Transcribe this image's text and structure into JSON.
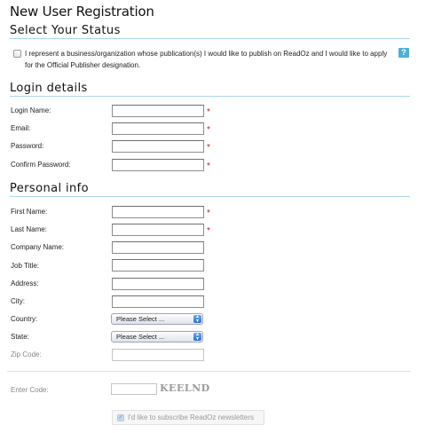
{
  "page": {
    "title": "New User Registration"
  },
  "status": {
    "heading": "Select Your Status",
    "checkbox_text": "I represent a business/organization whose publication(s) I would like to publish on ReadOz and I would like to apply for the Official Publisher designation.",
    "checked": false,
    "help_icon": "?"
  },
  "login": {
    "heading": "Login details",
    "fields": [
      {
        "label": "Login Name:",
        "value": "",
        "required": true
      },
      {
        "label": "Email:",
        "value": "",
        "required": true
      },
      {
        "label": "Password:",
        "value": "",
        "required": true
      },
      {
        "label": "Confirm Password:",
        "value": "",
        "required": true
      }
    ]
  },
  "personal": {
    "heading": "Personal info",
    "fields": [
      {
        "label": "First Name:",
        "value": "",
        "required": true
      },
      {
        "label": "Last Name:",
        "value": "",
        "required": true
      },
      {
        "label": "Company Name:",
        "value": "",
        "required": false
      },
      {
        "label": "Job Title:",
        "value": "",
        "required": false
      },
      {
        "label": "Address:",
        "value": "",
        "required": false
      },
      {
        "label": "City:",
        "value": "",
        "required": false
      }
    ],
    "country": {
      "label": "Country:",
      "selected": "Please Select ..."
    },
    "state": {
      "label": "State:",
      "selected": "Please Select ..."
    },
    "zip": {
      "label": "Zip Code:",
      "value": ""
    }
  },
  "required_marker": "*",
  "captcha": {
    "label": "Enter Code:",
    "value": "",
    "code": "KEELND"
  },
  "newsletter": {
    "label": "I'd like to subscribe ReadOz newsletters",
    "checked": true,
    "check_glyph": "✓"
  },
  "colors": {
    "accent_rule": "#a9d7e8",
    "required_star": "#c02020",
    "help_icon_bg": "#4bb0d6"
  }
}
